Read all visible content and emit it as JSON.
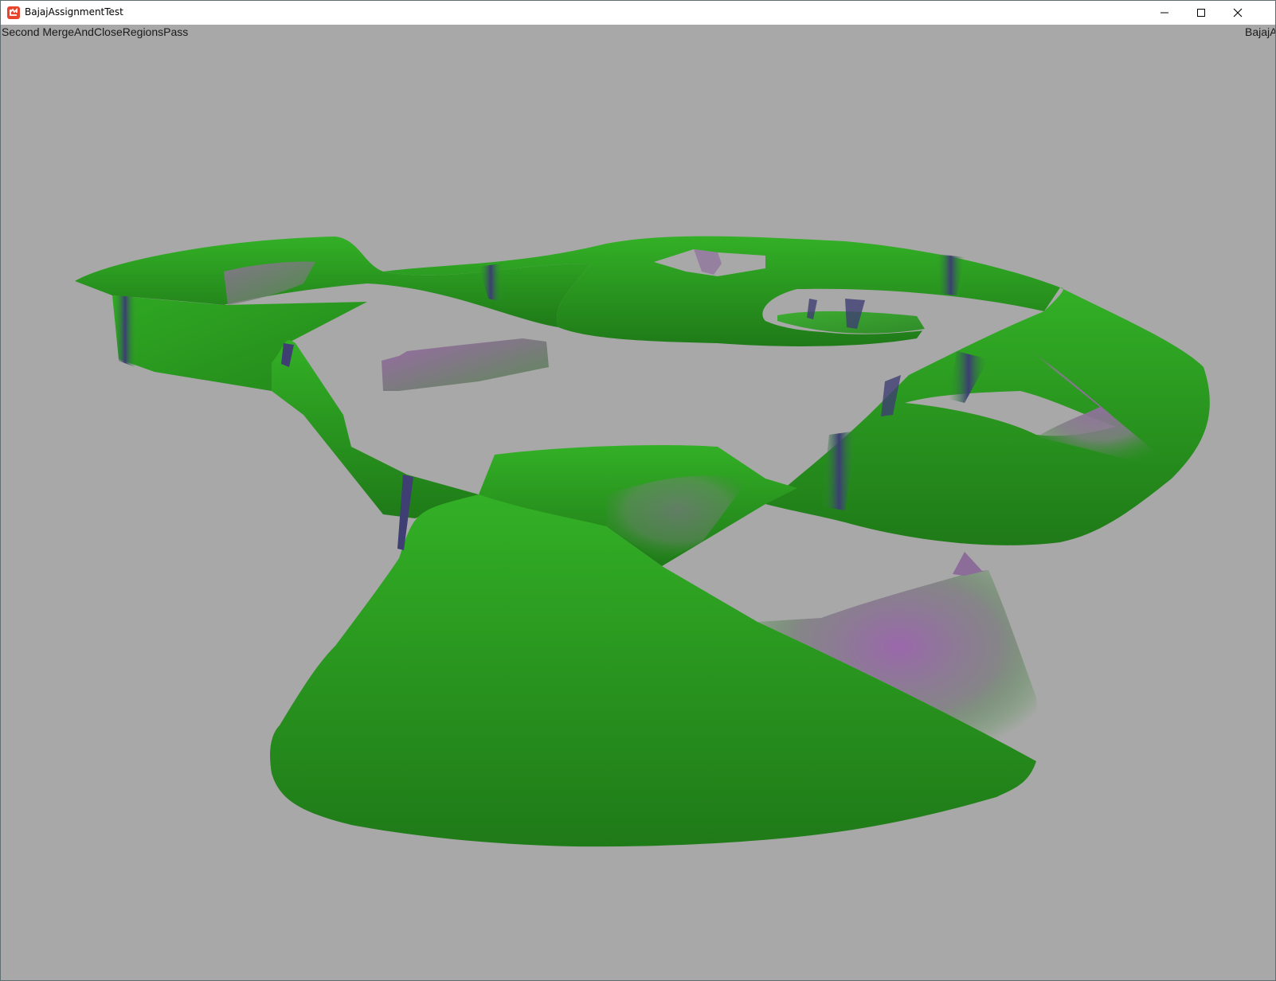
{
  "window": {
    "title": "BajajAssignmentTest",
    "icon": "monogame-logo-icon",
    "controls": {
      "minimize": "minimize-icon",
      "maximize": "maximize-icon",
      "close": "close-icon"
    }
  },
  "hud": {
    "left_text": "Second MergeAndCloseRegionsPass",
    "right_text": "BajajA"
  },
  "colors": {
    "background": "#a8a8a8",
    "mesh_green": "#2ea322",
    "mesh_green_dark": "#1f7a18",
    "mesh_purple": "#9a6aa8",
    "mesh_seam": "#3f3f73",
    "icon_red": "#e8452c"
  }
}
